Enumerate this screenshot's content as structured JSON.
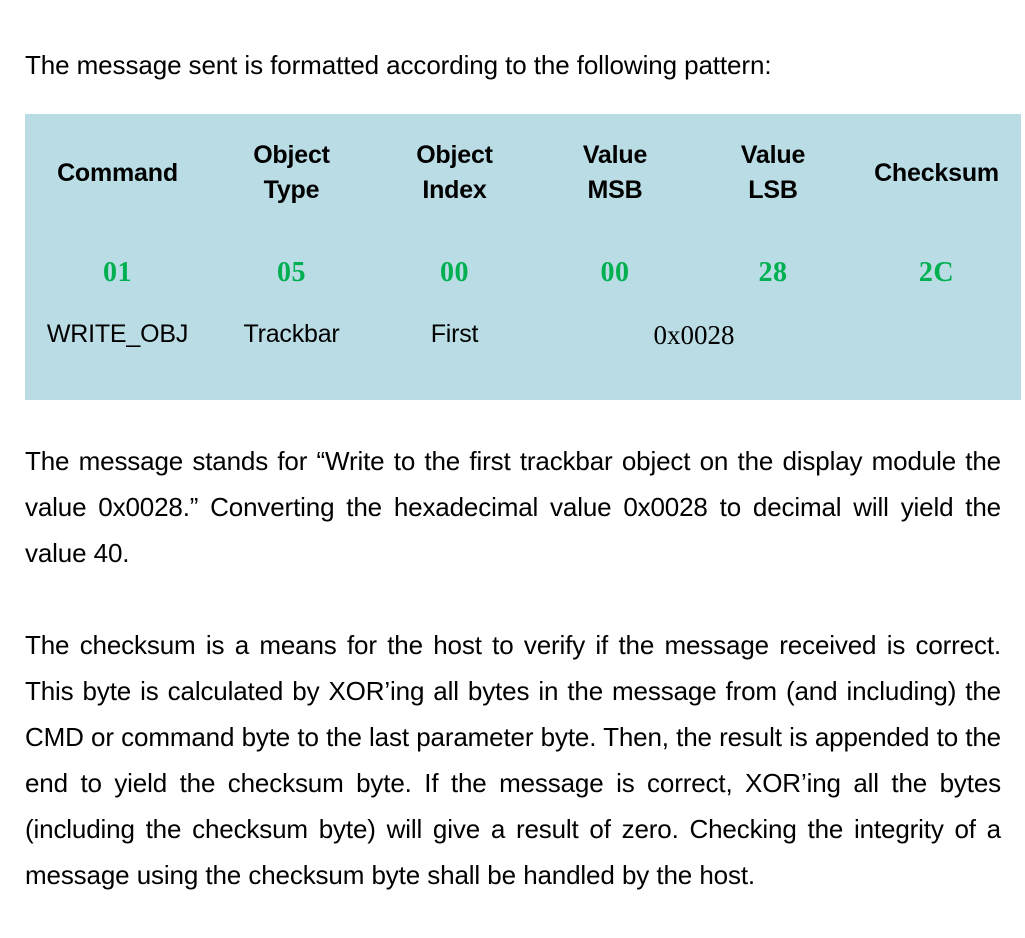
{
  "document": {
    "intro_line": "The message sent is formatted according to the following pattern:",
    "colors": {
      "table_background": "#b9dce5",
      "hex_value_text": "#00b050",
      "body_text": "#000000",
      "page_background": "#ffffff"
    },
    "message_table": {
      "headers": [
        {
          "line1": "Command",
          "line2": ""
        },
        {
          "line1": "Object",
          "line2": "Type"
        },
        {
          "line1": "Object",
          "line2": "Index"
        },
        {
          "line1": "Value",
          "line2": "MSB"
        },
        {
          "line1": "Value",
          "line2": "LSB"
        },
        {
          "line1": "Checksum",
          "line2": ""
        }
      ],
      "hex_values": [
        "01",
        "05",
        "00",
        "00",
        "28",
        "2C"
      ],
      "descriptions": {
        "command": "WRITE_OBJ",
        "object_type": "Trackbar",
        "object_index": "First",
        "value": "0x0028",
        "checksum": ""
      }
    },
    "paragraphs": [
      "The message stands for “Write to the first trackbar object on the display module the value 0x0028.” Converting the hexadecimal value 0x0028 to decimal will yield the value 40.",
      "The checksum is a means for the host to verify if the message received is correct. This byte is calculated by XOR’ing all bytes in the message from (and including) the CMD or command byte to the last parameter byte. Then, the result is appended to the end to yield the checksum byte. If the message is correct, XOR’ing all the bytes (including the checksum byte) will give a result of zero. Checking the integrity of a message using the checksum byte shall be handled by the host."
    ]
  }
}
